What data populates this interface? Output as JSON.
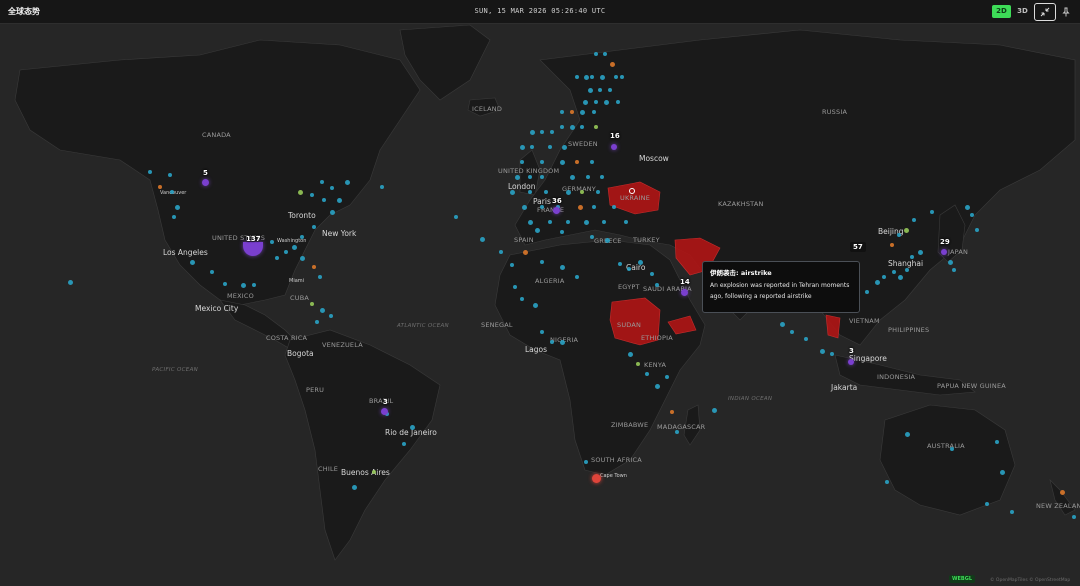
{
  "app": {
    "title": "全球态势"
  },
  "clock": "SUN, 15 MAR 2026 05:26:40 UTC",
  "view_toggle": {
    "mode_2d": "2D",
    "mode_3d": "3D",
    "active": "2D"
  },
  "toolbar": {
    "fullscreen_icon": "collapse-arrows-icon",
    "pin_icon": "pin-icon"
  },
  "map": {
    "countries": {
      "canada": "CANADA",
      "united_states": "UNITED STATES",
      "mexico": "MEXICO",
      "cuba": "CUBA",
      "costa_rica": "COSTA RICA",
      "venezuela": "VENEZUELA",
      "peru": "PERU",
      "brazil": "BRAZIL",
      "chile": "CHILE",
      "iceland": "ICELAND",
      "sweden": "SWEDEN",
      "united_kingdom": "UNITED KINGDOM",
      "germany": "GERMANY",
      "france": "FRANCE",
      "spain": "SPAIN",
      "greece": "GREECE",
      "ukraine": "UKRAINE",
      "turkey": "TURKEY",
      "russia": "RUSSIA",
      "kazakhstan": "KAZAKHSTAN",
      "algeria": "ALGERIA",
      "egypt": "EGYPT",
      "saudi_arabia": "SAUDI ARABIA",
      "senegal": "SENEGAL",
      "nigeria": "NIGERIA",
      "sudan": "SUDAN",
      "ethiopia": "ETHIOPIA",
      "kenya": "KENYA",
      "zimbabwe": "ZIMBABWE",
      "madagascar": "MADAGASCAR",
      "south_africa": "SOUTH AFRICA",
      "japan": "JAPAN",
      "vietnam": "VIETNAM",
      "philippines": "PHILIPPINES",
      "indonesia": "INDONESIA",
      "papua_new_guinea": "PAPUA NEW GUINEA",
      "australia": "AUSTRALIA",
      "new_zealand": "NEW ZEALAND"
    },
    "oceans": {
      "atlantic": "ATLANTIC OCEAN",
      "pacific": "PACIFIC OCEAN",
      "indian": "INDIAN OCEAN"
    },
    "cities": {
      "vancouver": "Vancouver",
      "toronto": "Toronto",
      "washington": "Washington",
      "new_york": "New York",
      "los_angeles": "Los Angeles",
      "miami": "Miami",
      "mexico_city": "Mexico City",
      "bogota": "Bogota",
      "rio": "Rio de Janeiro",
      "buenos_aires": "Buenos Aires",
      "london": "London",
      "paris": "Paris",
      "moscow": "Moscow",
      "cairo": "Cairo",
      "lagos": "Lagos",
      "beijing": "Beijing",
      "shanghai": "Shanghai",
      "singapore": "Singapore",
      "jakarta": "Jakarta",
      "cape_town": "Cape Town"
    },
    "clusters": {
      "us": "137",
      "canada": "5",
      "europe": "36",
      "nordic": "16",
      "middle_east": "14",
      "east_asia": "57",
      "japan": "29",
      "singapore": "3",
      "brazil": "3"
    },
    "colors": {
      "land": "#1a1a1a",
      "water": "#262626",
      "conflict": "#b01515",
      "news_dot": "#2aa6c9",
      "cluster": "#7a3fcf",
      "alert": "#e0443a",
      "orange": "#e07a2a"
    }
  },
  "tooltip": {
    "title": "伊朗袭击: airstrike",
    "body": "An explosion was reported in Tehran moments ago, following a reported airstrike"
  },
  "footer": {
    "renderer": "WEBGL",
    "attribution": "© OpenMapTiles © OpenStreetMap"
  }
}
